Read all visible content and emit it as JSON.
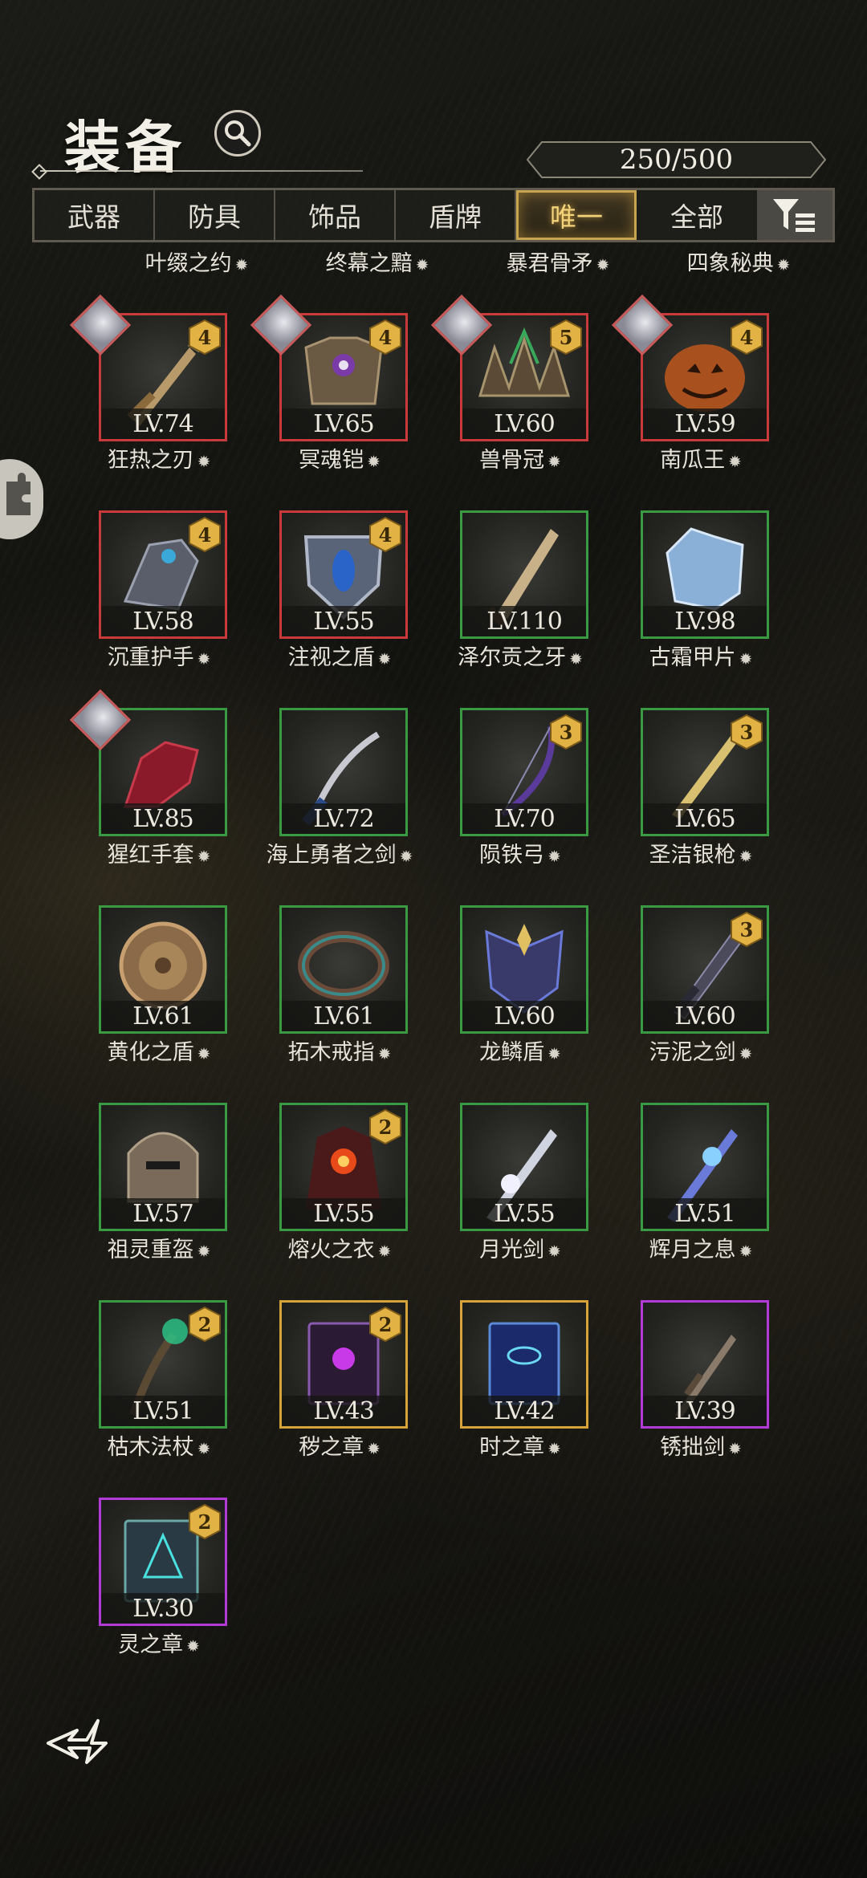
{
  "header": {
    "title": "装备",
    "capacity": "250/500"
  },
  "tabs": [
    {
      "label": "武器"
    },
    {
      "label": "防具"
    },
    {
      "label": "饰品"
    },
    {
      "label": "盾牌"
    },
    {
      "label": "唯一",
      "active": true
    },
    {
      "label": "全部"
    }
  ],
  "partial_row": [
    "叶缀之约",
    "终幕之黯",
    "暴君骨矛",
    "四象秘典"
  ],
  "items": [
    {
      "name": "狂热之刃",
      "level": "LV.74",
      "rarity": "red",
      "upgrade": "4",
      "portrait": true,
      "icon": "sword-icon"
    },
    {
      "name": "冥魂铠",
      "level": "LV.65",
      "rarity": "red",
      "upgrade": "4",
      "portrait": true,
      "icon": "armor-icon"
    },
    {
      "name": "兽骨冠",
      "level": "LV.60",
      "rarity": "red",
      "upgrade": "5",
      "portrait": true,
      "icon": "crown-icon"
    },
    {
      "name": "南瓜王",
      "level": "LV.59",
      "rarity": "red",
      "upgrade": "4",
      "portrait": true,
      "icon": "pumpkin-icon"
    },
    {
      "name": "沉重护手",
      "level": "LV.58",
      "rarity": "red",
      "upgrade": "4",
      "portrait": false,
      "icon": "gauntlet-icon"
    },
    {
      "name": "注视之盾",
      "level": "LV.55",
      "rarity": "red",
      "upgrade": "4",
      "portrait": false,
      "icon": "shield-icon"
    },
    {
      "name": "泽尔贡之牙",
      "level": "LV.110",
      "rarity": "green",
      "upgrade": "",
      "portrait": false,
      "icon": "dagger-icon"
    },
    {
      "name": "古霜甲片",
      "level": "LV.98",
      "rarity": "green",
      "upgrade": "",
      "portrait": false,
      "icon": "crystal-icon"
    },
    {
      "name": "猩红手套",
      "level": "LV.85",
      "rarity": "green",
      "upgrade": "",
      "portrait": true,
      "icon": "glove-icon"
    },
    {
      "name": "海上勇者之剑",
      "level": "LV.72",
      "rarity": "green",
      "upgrade": "",
      "portrait": false,
      "icon": "saber-icon"
    },
    {
      "name": "陨铁弓",
      "level": "LV.70",
      "rarity": "green",
      "upgrade": "3",
      "portrait": false,
      "icon": "bow-icon"
    },
    {
      "name": "圣洁银枪",
      "level": "LV.65",
      "rarity": "green",
      "upgrade": "3",
      "portrait": false,
      "icon": "lance-icon"
    },
    {
      "name": "黄化之盾",
      "level": "LV.61",
      "rarity": "green",
      "upgrade": "",
      "portrait": false,
      "icon": "round-shield-icon"
    },
    {
      "name": "拓木戒指",
      "level": "LV.61",
      "rarity": "green",
      "upgrade": "",
      "portrait": false,
      "icon": "ring-icon"
    },
    {
      "name": "龙鳞盾",
      "level": "LV.60",
      "rarity": "green",
      "upgrade": "",
      "portrait": false,
      "icon": "dragon-shield-icon"
    },
    {
      "name": "污泥之剑",
      "level": "LV.60",
      "rarity": "green",
      "upgrade": "3",
      "portrait": false,
      "icon": "greatsword-icon"
    },
    {
      "name": "祖灵重盔",
      "level": "LV.57",
      "rarity": "green",
      "upgrade": "",
      "portrait": false,
      "icon": "helmet-icon"
    },
    {
      "name": "熔火之衣",
      "level": "LV.55",
      "rarity": "green",
      "upgrade": "2",
      "portrait": false,
      "icon": "robe-icon"
    },
    {
      "name": "月光剑",
      "level": "LV.55",
      "rarity": "green",
      "upgrade": "",
      "portrait": false,
      "icon": "moon-sword-icon"
    },
    {
      "name": "辉月之息",
      "level": "LV.51",
      "rarity": "green",
      "upgrade": "",
      "portrait": false,
      "icon": "blue-sword-icon"
    },
    {
      "name": "枯木法杖",
      "level": "LV.51",
      "rarity": "green",
      "upgrade": "2",
      "portrait": false,
      "icon": "staff-icon"
    },
    {
      "name": "秽之章",
      "level": "LV.43",
      "rarity": "gold",
      "upgrade": "2",
      "portrait": false,
      "icon": "dark-tome-icon"
    },
    {
      "name": "时之章",
      "level": "LV.42",
      "rarity": "gold",
      "upgrade": "",
      "portrait": false,
      "icon": "blue-tome-icon"
    },
    {
      "name": "锈拙剑",
      "level": "LV.39",
      "rarity": "purple",
      "upgrade": "",
      "portrait": false,
      "icon": "rusty-sword-icon"
    },
    {
      "name": "灵之章",
      "level": "LV.30",
      "rarity": "purple",
      "upgrade": "2",
      "portrait": false,
      "icon": "spirit-tome-icon"
    }
  ],
  "colors": {
    "red": "#c93a3a",
    "green": "#3a9a44",
    "gold": "#d6a23a",
    "purple": "#b23ad6",
    "tab_active": "#f3d27a",
    "badge": "#e2b244"
  }
}
